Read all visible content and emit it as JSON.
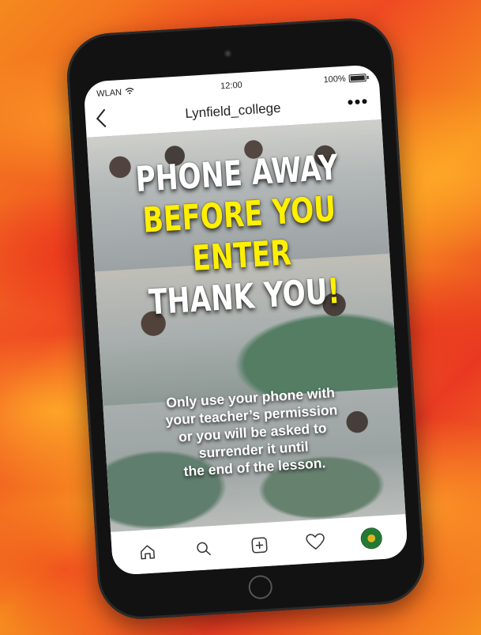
{
  "status_bar": {
    "carrier": "WLAN",
    "time": "12:00",
    "battery": "100%",
    "battery_level": 1.0
  },
  "post_header": {
    "back_icon": "chevron-left-icon",
    "username": "Lynfield_college",
    "more_icon": "more-horizontal-icon"
  },
  "post": {
    "headline": {
      "line1": "PHONE AWAY",
      "line2": "BEFORE YOU",
      "line3": "ENTER",
      "line4_main": "THANK YOU",
      "line4_mark": "!"
    },
    "subtext": {
      "line1": "Only use your phone with",
      "line2": "your teacher’s permission",
      "line3": "or you will be asked to",
      "line4": "surrender it until",
      "line5": "the end of the lesson."
    },
    "colors": {
      "headline_white": "#ffffff",
      "headline_yellow": "#ffef00"
    }
  },
  "bottom_nav": {
    "items": [
      {
        "icon": "home-icon"
      },
      {
        "icon": "search-icon"
      },
      {
        "icon": "add-post-icon"
      },
      {
        "icon": "heart-icon"
      },
      {
        "icon": "profile-avatar"
      }
    ]
  },
  "theme": {
    "background_orange": "#f58a1e",
    "background_red": "#ea3b22",
    "phone_body": "#121212"
  }
}
